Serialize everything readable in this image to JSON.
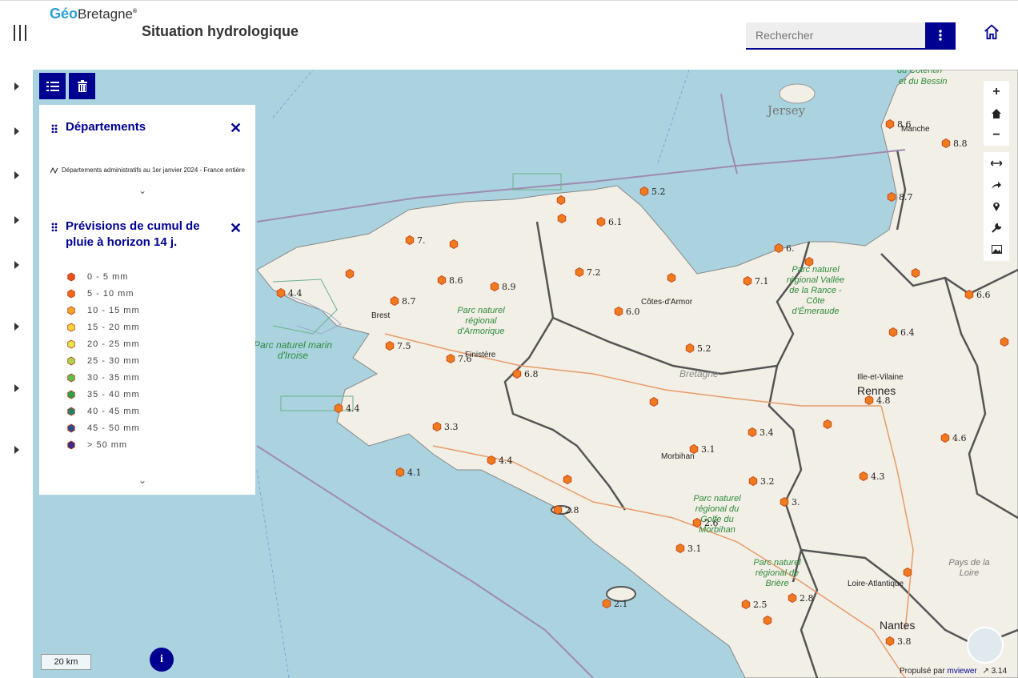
{
  "header": {
    "logo_geo": "Géo",
    "logo_bretagne": "Bretagne",
    "logo_mark": "®",
    "title": "Situation hydrologique",
    "search_placeholder": "Rechercher",
    "search_button_icon": "more-vertical-icon",
    "home_icon": "home-icon"
  },
  "toolbar": {
    "layers_icon": "list-icon",
    "trash_icon": "trash-icon"
  },
  "panel": {
    "layer1_title": "Départements",
    "layer1_subtitle": "Départements administratifs au 1er janvier 2024 - France entière",
    "layer2_title": "Prévisions de cumul de pluie à horizon 14 j.",
    "legend": [
      {
        "label": "0 - 5 mm",
        "color": "#e8501e"
      },
      {
        "label": "5 - 10  mm",
        "color": "#f26b1d"
      },
      {
        "label": "10 - 15  mm",
        "color": "#f7a42a"
      },
      {
        "label": "15 - 20  mm",
        "color": "#fbd43a"
      },
      {
        "label": "20 - 25  mm",
        "color": "#e6e84a"
      },
      {
        "label": "25 - 30  mm",
        "color": "#a7d64e"
      },
      {
        "label": "30 - 35  mm",
        "color": "#5fbf4a"
      },
      {
        "label": "35 - 40  mm",
        "color": "#2e9e4c"
      },
      {
        "label": "40 - 45  mm",
        "color": "#23806a"
      },
      {
        "label": "45 - 50  mm",
        "color": "#2d4a8a"
      },
      {
        "label": "> 50 mm",
        "color": "#3a2a8c"
      }
    ]
  },
  "map_tools": [
    "zoom-in-icon",
    "home-icon",
    "zoom-out-icon",
    "measure-distance-icon",
    "share-icon",
    "location-pin-icon",
    "wrench-icon",
    "image-icon"
  ],
  "map_labels": {
    "jersey": "Jersey",
    "cotentin": "du Cotentin",
    "bessin": "et du Bessin",
    "manche": "Manche",
    "cotes_armor": "Côtes-d'Armor",
    "finistere": "Finistère",
    "brest": "Brest",
    "morbihan": "Morbihan",
    "bretagne": "Bretagne",
    "rennes": "Rennes",
    "ille_vilaine": "Ille-et-Vilaine",
    "loire_atlantique": "Loire-Atlantique",
    "nantes": "Nantes",
    "pays_loire": "Pays de la Loire",
    "pnr_armorique": "Parc naturel régional d'Armorique",
    "pnm_iroise": "Parc naturel marin d'Iroise",
    "pnr_rance": "Parc naturel régional Vallée de la Rance - Côte d'Émeraude",
    "pnr_morbihan": "Parc naturel régional du Golfe du Morbihan",
    "pnr_briere": "Parc naturel régional de Brière"
  },
  "stations": [
    "8.6",
    "8.8",
    "8.7",
    "5.2",
    "6.1",
    "5.",
    "7.",
    "6.7",
    "8.6",
    "8.9",
    "7.2",
    "7.1",
    "4.4",
    "8.7",
    "6.0",
    "6.",
    "6.6",
    "6.4",
    "7.5",
    "7.6",
    "6.8",
    "5.2",
    "4.8",
    "4.4",
    "3.3",
    "4.6",
    "3.4",
    "3.1",
    "4.4",
    "4.1",
    "3.2",
    "3.",
    "4.3",
    "3.6",
    "2.8",
    "2.6",
    "3.1",
    "2.5",
    "2.8",
    "2.1",
    "3.8"
  ],
  "scale": "20 km",
  "info_label": "i",
  "attribution": "Propulsé par ",
  "attribution_link": "mviewer",
  "version": "3.14"
}
